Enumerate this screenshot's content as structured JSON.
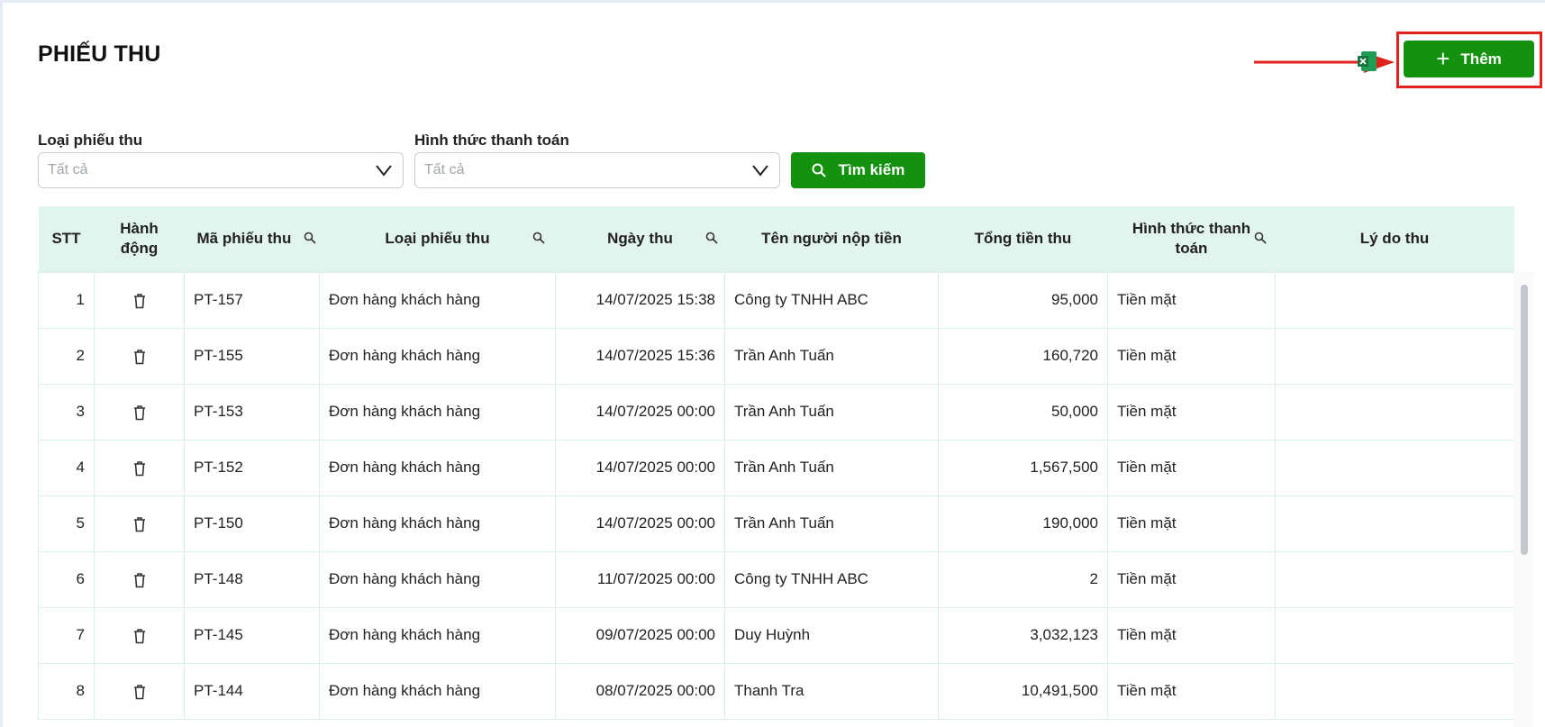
{
  "page": {
    "title": "PHIẾU THU"
  },
  "toolbar": {
    "add_label": "Thêm"
  },
  "filters": {
    "receipt_type": {
      "label": "Loại phiếu thu",
      "placeholder": "Tất cả"
    },
    "payment_method": {
      "label": "Hình thức thanh toán",
      "placeholder": "Tất cả"
    },
    "search_label": "Tìm kiếm"
  },
  "table": {
    "columns": {
      "stt": "STT",
      "action_line1": "Hành",
      "action_line2": "động",
      "code": "Mã phiếu thu",
      "type": "Loại phiếu thu",
      "date": "Ngày thu",
      "payer": "Tên người nộp tiền",
      "total": "Tổng tiền thu",
      "method_line1": "Hình thức thanh",
      "method_line2": "toán",
      "reason": "Lý do thu"
    },
    "rows": [
      {
        "stt": "1",
        "code": "PT-157",
        "type": "Đơn hàng khách hàng",
        "date": "14/07/2025 15:38",
        "payer": "Công ty TNHH ABC",
        "total": "95,000",
        "method": "Tiền mặt",
        "reason": ""
      },
      {
        "stt": "2",
        "code": "PT-155",
        "type": "Đơn hàng khách hàng",
        "date": "14/07/2025 15:36",
        "payer": "Trần Anh Tuấn",
        "total": "160,720",
        "method": "Tiền mặt",
        "reason": ""
      },
      {
        "stt": "3",
        "code": "PT-153",
        "type": "Đơn hàng khách hàng",
        "date": "14/07/2025 00:00",
        "payer": "Trần Anh Tuấn",
        "total": "50,000",
        "method": "Tiền mặt",
        "reason": ""
      },
      {
        "stt": "4",
        "code": "PT-152",
        "type": "Đơn hàng khách hàng",
        "date": "14/07/2025 00:00",
        "payer": "Trần Anh Tuấn",
        "total": "1,567,500",
        "method": "Tiền mặt",
        "reason": ""
      },
      {
        "stt": "5",
        "code": "PT-150",
        "type": "Đơn hàng khách hàng",
        "date": "14/07/2025 00:00",
        "payer": "Trần Anh Tuấn",
        "total": "190,000",
        "method": "Tiền mặt",
        "reason": ""
      },
      {
        "stt": "6",
        "code": "PT-148",
        "type": "Đơn hàng khách hàng",
        "date": "11/07/2025 00:00",
        "payer": "Công ty TNHH ABC",
        "total": "2",
        "method": "Tiền mặt",
        "reason": ""
      },
      {
        "stt": "7",
        "code": "PT-145",
        "type": "Đơn hàng khách hàng",
        "date": "09/07/2025 00:00",
        "payer": "Duy Huỳnh",
        "total": "3,032,123",
        "method": "Tiền mặt",
        "reason": ""
      },
      {
        "stt": "8",
        "code": "PT-144",
        "type": "Đơn hàng khách hàng",
        "date": "08/07/2025 00:00",
        "payer": "Thanh Tra",
        "total": "10,491,500",
        "method": "Tiền mặt",
        "reason": ""
      }
    ]
  },
  "icons": {
    "add": "plus-icon",
    "search": "search-icon",
    "delete": "trash-icon",
    "export": "excel-icon",
    "dropdown": "chevron-down-icon"
  },
  "colors": {
    "primary": "#14920f",
    "header_bg": "#e2f4ee",
    "annotation": "#e0201b"
  }
}
